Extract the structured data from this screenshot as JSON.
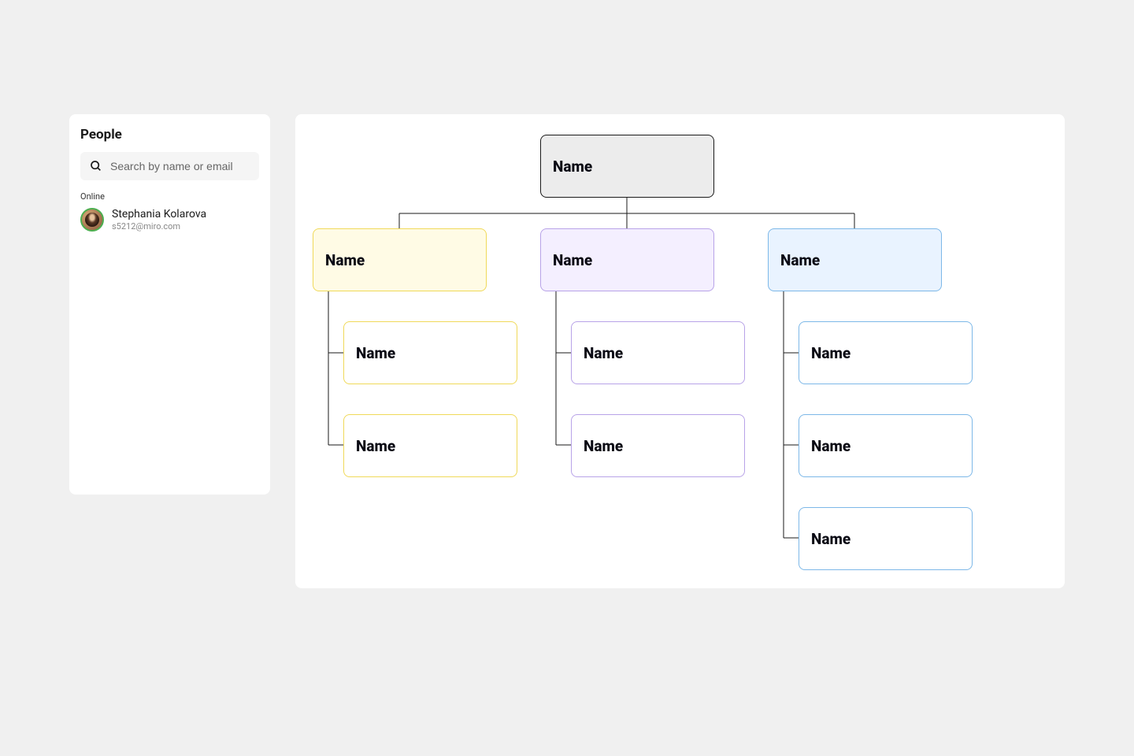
{
  "sidebar": {
    "title": "People",
    "search_placeholder": "Search by name or email",
    "section_label": "Online",
    "person": {
      "name": "Stephania Kolarova",
      "email": "s5212@miro.com"
    }
  },
  "chart_data": {
    "type": "org-chart",
    "root": {
      "label": "Name",
      "color": "gray",
      "children": [
        {
          "label": "Name",
          "color": "yellow",
          "children": [
            {
              "label": "Name"
            },
            {
              "label": "Name"
            }
          ]
        },
        {
          "label": "Name",
          "color": "purple",
          "children": [
            {
              "label": "Name"
            },
            {
              "label": "Name"
            }
          ]
        },
        {
          "label": "Name",
          "color": "blue",
          "children": [
            {
              "label": "Name"
            },
            {
              "label": "Name"
            },
            {
              "label": "Name"
            }
          ]
        }
      ]
    }
  }
}
